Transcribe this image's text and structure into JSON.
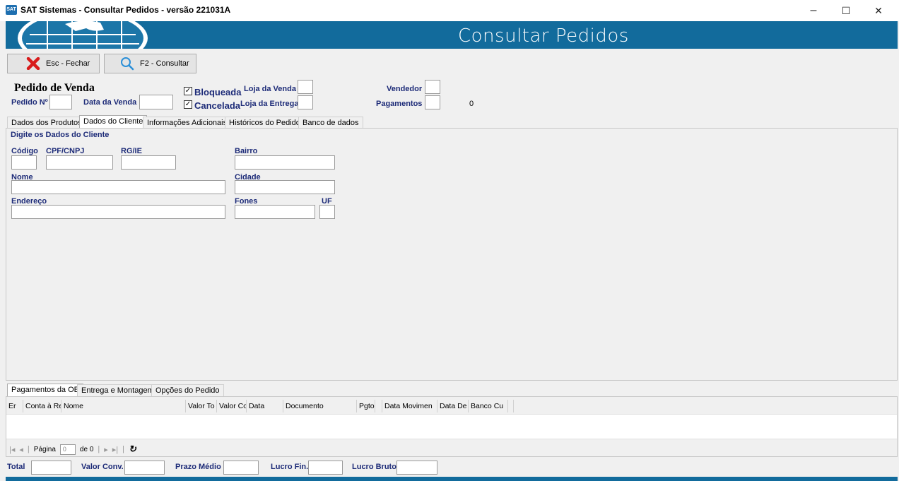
{
  "window": {
    "title": "SAT Sistemas - Consultar Pedidos - versão 221031A",
    "icon_label": "SAT",
    "minimize": "–",
    "maximize": "☐",
    "close": "✕"
  },
  "banner": {
    "title": "Consultar Pedidos",
    "color": "#126b9c"
  },
  "toolbar": {
    "close_label": "Esc - Fechar",
    "search_label": "F2 - Consultar"
  },
  "header": {
    "section_title": "Pedido de Venda",
    "pedido_label": "Pedido Nº",
    "data_venda_label": "Data da Venda",
    "bloqueada_label": "Bloqueada",
    "cancelada_label": "Cancelada",
    "check_mark": "✓",
    "loja_venda_label": "Loja da Venda",
    "loja_entrega_label": "Loja da Entrega",
    "vendedor_label": "Vendedor",
    "pagamentos_label": "Pagamentos",
    "pagamentos_value": "0"
  },
  "tabs": [
    {
      "label": "Dados dos Produtos"
    },
    {
      "label": "Dados do Cliente"
    },
    {
      "label": "Informações Adicionais"
    },
    {
      "label": "Históricos do Pedido"
    },
    {
      "label": "Banco de dados"
    }
  ],
  "client": {
    "section_title": "Digite os Dados do Cliente",
    "codigo_label": "Código",
    "cpf_label": "CPF/CNPJ",
    "rg_label": "RG/IE",
    "bairro_label": "Bairro",
    "nome_label": "Nome",
    "cidade_label": "Cidade",
    "endereco_label": "Endereço",
    "fones_label": "Fones",
    "uf_label": "UF"
  },
  "bottom_tabs": [
    {
      "label": "Pagamentos da OE"
    },
    {
      "label": "Entrega e Montagem"
    },
    {
      "label": "Opções do Pedido"
    }
  ],
  "grid": {
    "columns": [
      "Er",
      "Conta à Re",
      "Nome",
      "Valor To",
      "Valor Co",
      "Data",
      "Documento",
      "Pgto",
      "",
      "Data Movimen",
      "Data De",
      "Banco Cu",
      ""
    ],
    "pager_page_label": "Página",
    "pager_page_value": "0",
    "pager_of_label": "de 0"
  },
  "footer": {
    "total_label": "Total",
    "valor_conv_label": "Valor Conv.",
    "prazo_medio_label": "Prazo Médio",
    "lucro_fin_label": "Lucro Fin.",
    "lucro_bruto_label": "Lucro Bruto"
  }
}
